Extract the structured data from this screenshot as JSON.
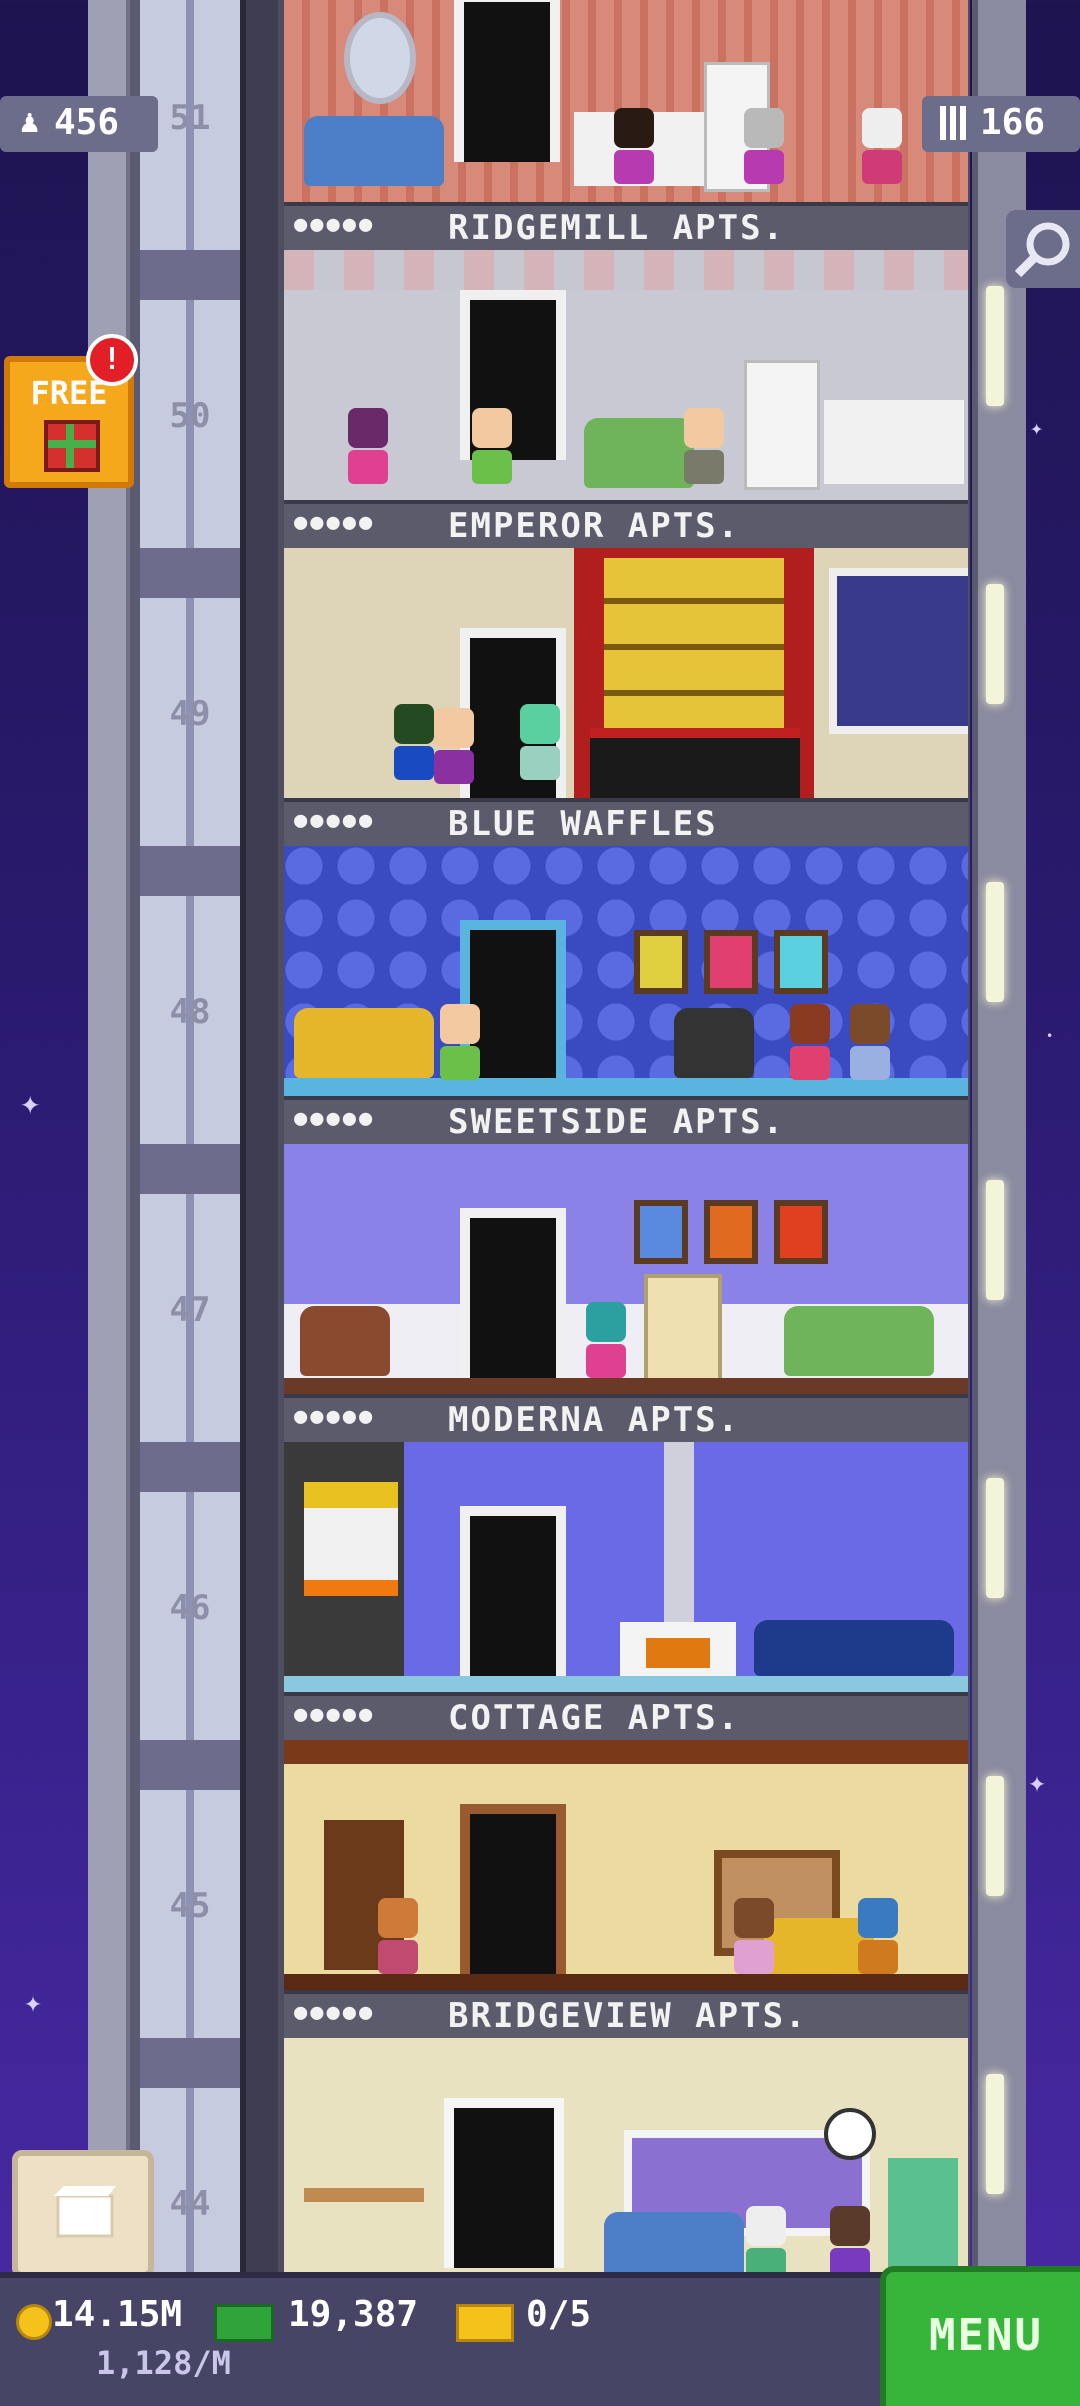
{
  "hud": {
    "population": "456",
    "floor_count": "166",
    "free_label": "FREE",
    "alert_badge": "!"
  },
  "floors": [
    {
      "number": "51",
      "name": "RIDGEMILL APTS."
    },
    {
      "number": "50",
      "name": "EMPEROR APTS."
    },
    {
      "number": "49",
      "name": "BLUE WAFFLES"
    },
    {
      "number": "48",
      "name": "SWEETSIDE APTS."
    },
    {
      "number": "47",
      "name": "MODERNA APTS."
    },
    {
      "number": "46",
      "name": "COTTAGE APTS."
    },
    {
      "number": "45",
      "name": "BRIDGEVIEW APTS."
    },
    {
      "number": "44",
      "name": ""
    }
  ],
  "bottom_bar": {
    "coins": "14.15M",
    "coins_rate": "1,128/M",
    "bux": "19,387",
    "tickets": "0/5",
    "menu_label": "MENU"
  },
  "colors": {
    "background": "#2a1a6e",
    "menu_green": "#37b53a",
    "free_orange": "#f5a81c",
    "alert_red": "#e21e26"
  },
  "icons": [
    "person-icon",
    "building-icon",
    "search-icon",
    "gift-icon",
    "box-icon",
    "coin-icon",
    "bux-icon",
    "ticket-icon"
  ]
}
